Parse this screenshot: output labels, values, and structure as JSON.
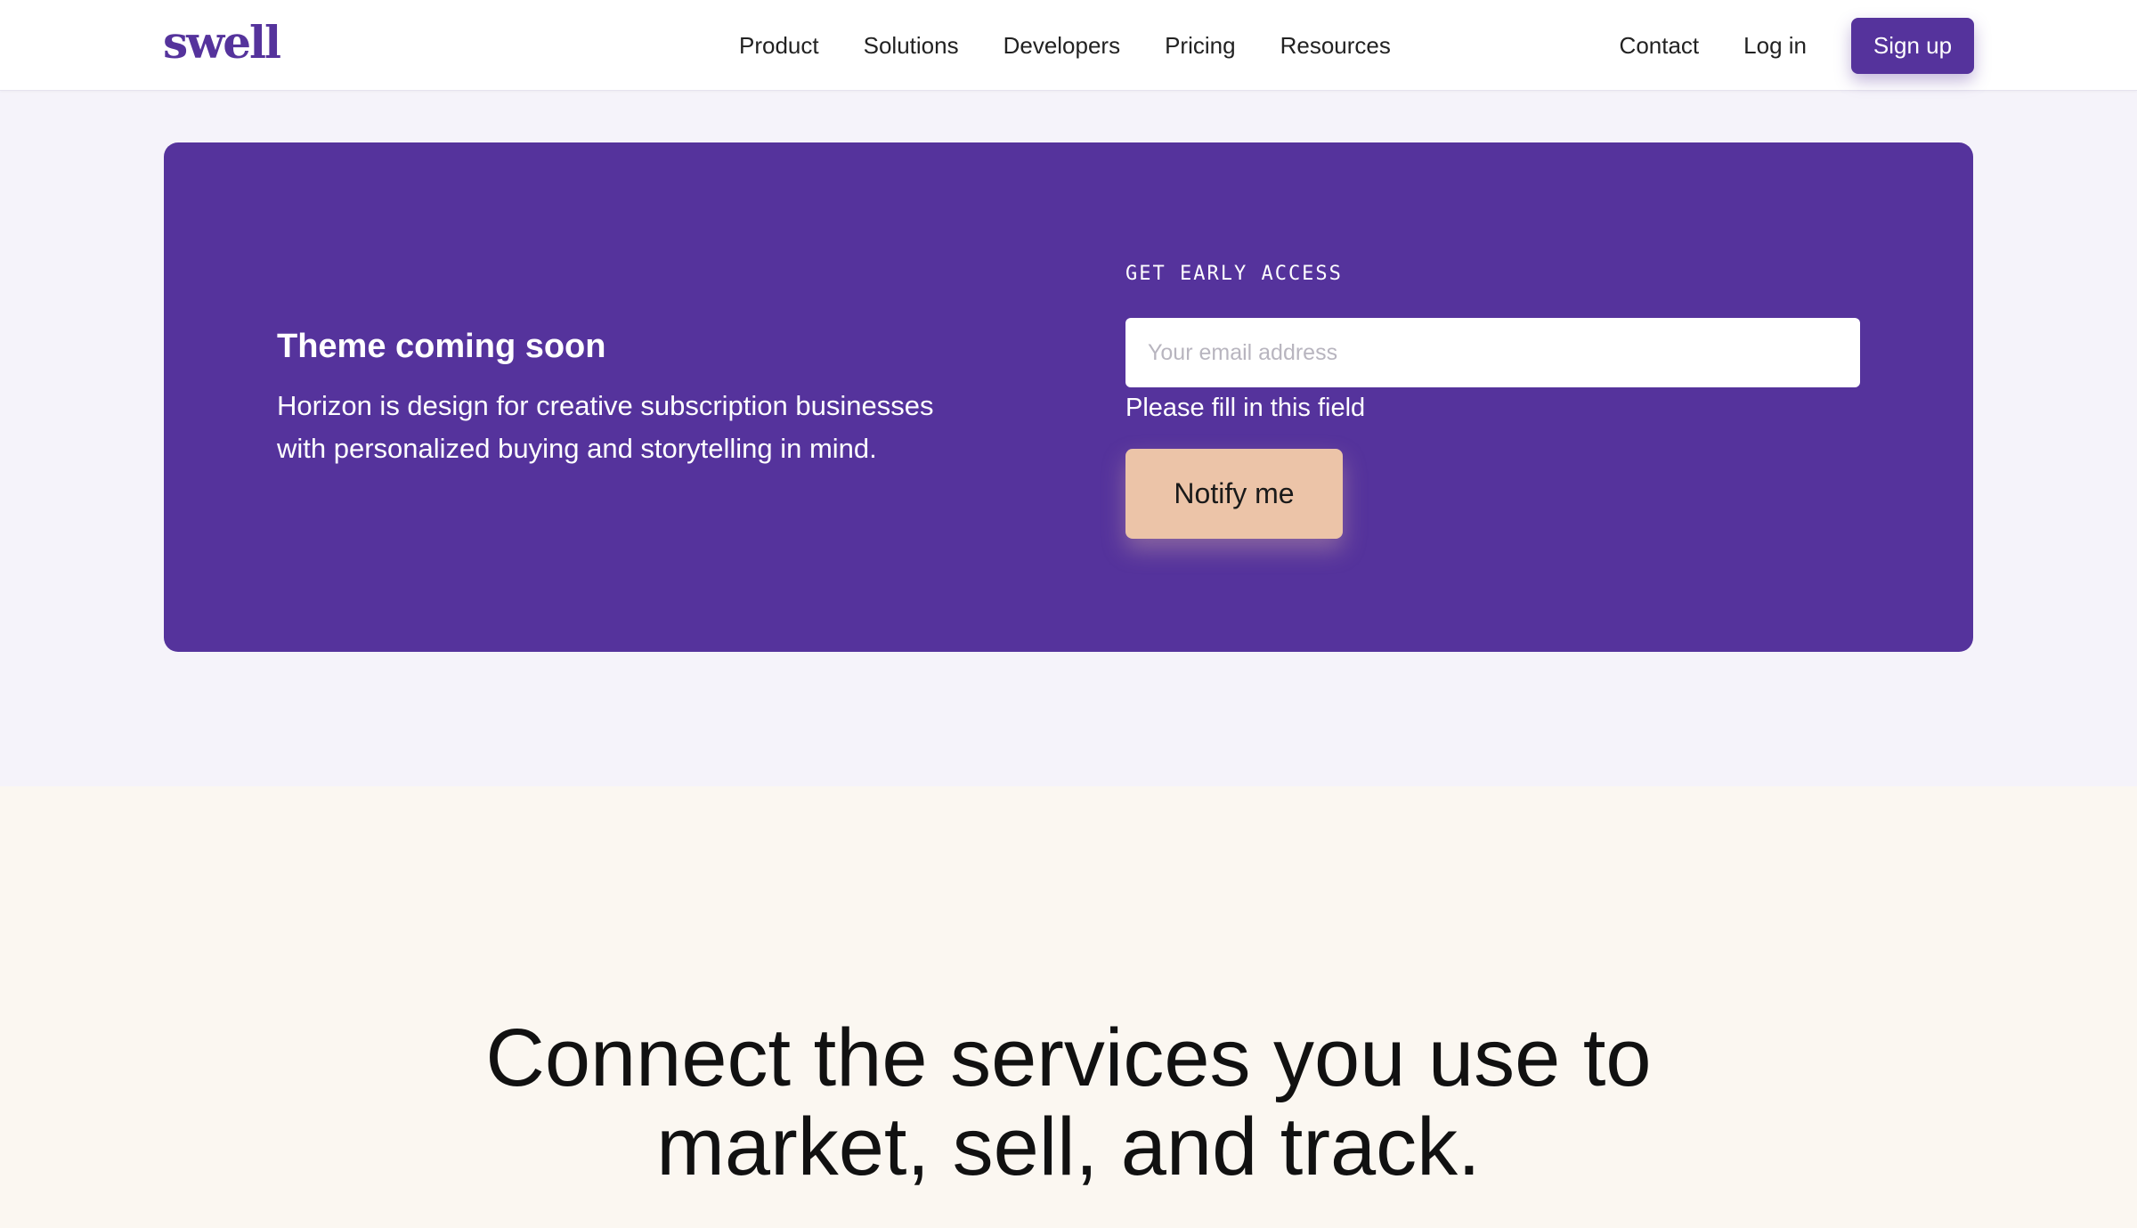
{
  "header": {
    "logo": "swell",
    "nav": [
      "Product",
      "Solutions",
      "Developers",
      "Pricing",
      "Resources"
    ],
    "contact": "Contact",
    "login": "Log in",
    "signup": "Sign up"
  },
  "panel": {
    "title": "Theme coming soon",
    "description": "Horizon is design for creative subscription businesses with personalized buying and storytelling in mind.",
    "early_access_label": "GET EARLY ACCESS",
    "email_placeholder": "Your email address",
    "email_value": "",
    "validation_message": "Please fill in this field",
    "notify_label": "Notify me"
  },
  "bottom": {
    "heading_line1": "Connect the services you use to",
    "heading_line2": "market, sell, and track."
  },
  "colors": {
    "brand_purple": "#55339c",
    "notify_peach": "#ecc4a8",
    "page_bg": "#f5f3fa",
    "bottom_bg": "#fbf7f1"
  }
}
